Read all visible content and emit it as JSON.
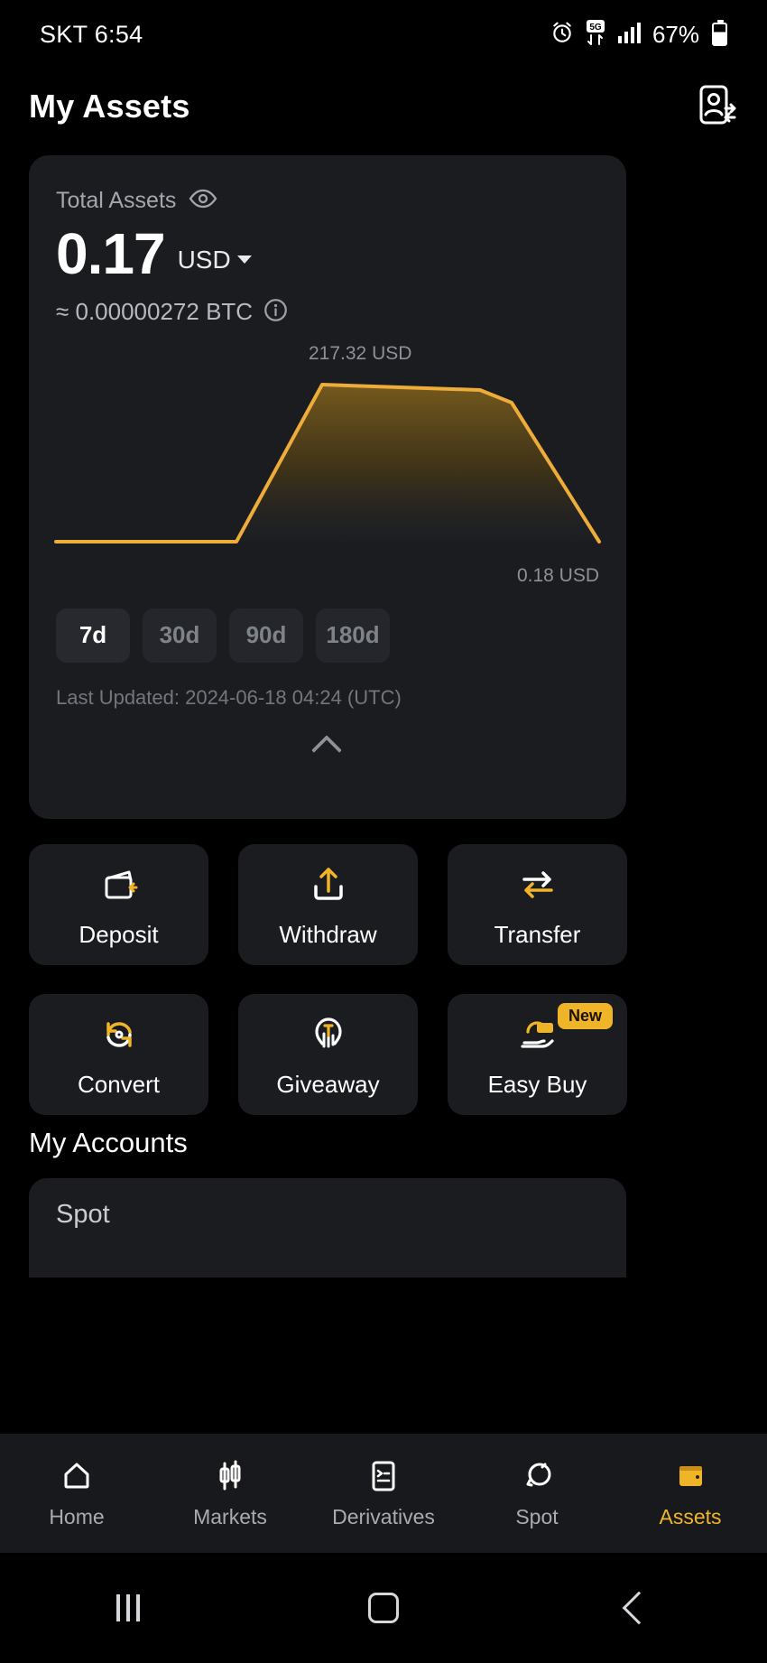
{
  "status_bar": {
    "carrier_time": "SKT 6:54",
    "alarm_icon": "alarm-icon",
    "network_icon": "5g-icon",
    "signal_icon": "signal-bars-icon",
    "battery_percent": "67%",
    "battery_icon": "battery-icon"
  },
  "header": {
    "title": "My Assets",
    "action_icon": "contact-transfer-icon"
  },
  "assets_card": {
    "total_label": "Total Assets",
    "eye_icon": "eye-icon",
    "amount": "0.17",
    "currency": "USD",
    "currency_caret_icon": "chevron-down-icon",
    "btc_equivalent": "≈ 0.00000272 BTC",
    "info_icon": "info-icon",
    "chart_high_label": "217.32 USD",
    "chart_low_label": "0.18 USD",
    "ranges": [
      {
        "label": "7d",
        "active": true
      },
      {
        "label": "30d",
        "active": false
      },
      {
        "label": "90d",
        "active": false
      },
      {
        "label": "180d",
        "active": false
      }
    ],
    "last_updated": "Last Updated: 2024-06-18 04:24 (UTC)",
    "collapse_icon": "chevron-up-icon"
  },
  "chart_data": {
    "type": "area",
    "title": "Total assets over 7 days",
    "xlabel": "",
    "ylabel": "USD",
    "x": [
      0,
      1,
      2,
      3,
      4,
      5,
      6
    ],
    "values": [
      0.18,
      0.18,
      0.18,
      217.32,
      214.0,
      205.0,
      0.18
    ],
    "annotations": [
      "217.32 USD",
      "0.18 USD"
    ],
    "ylim": [
      0,
      217.32
    ],
    "grid": false,
    "legend": "none",
    "line_color": "#eeac3a",
    "fill_color": "#6b521a"
  },
  "actions": [
    {
      "label": "Deposit",
      "icon": "wallet-deposit-icon",
      "badge": null
    },
    {
      "label": "Withdraw",
      "icon": "upload-withdraw-icon",
      "badge": null
    },
    {
      "label": "Transfer",
      "icon": "transfer-arrows-icon",
      "badge": null
    },
    {
      "label": "Convert",
      "icon": "convert-refresh-icon",
      "badge": null
    },
    {
      "label": "Giveaway",
      "icon": "hand-coin-icon",
      "badge": null
    },
    {
      "label": "Easy Buy",
      "icon": "hand-card-icon",
      "badge": "New"
    }
  ],
  "accounts": {
    "section_title": "My Accounts",
    "items": [
      {
        "label": "Spot"
      }
    ]
  },
  "bottom_nav": [
    {
      "label": "Home",
      "icon": "home-icon",
      "active": false
    },
    {
      "label": "Markets",
      "icon": "candlestick-icon",
      "active": false
    },
    {
      "label": "Derivatives",
      "icon": "document-list-icon",
      "active": false
    },
    {
      "label": "Spot",
      "icon": "spot-circles-icon",
      "active": false
    },
    {
      "label": "Assets",
      "icon": "wallet-icon",
      "active": true
    }
  ],
  "system_bar": {
    "recent_icon": "recent-apps-icon",
    "home_icon": "home-square-icon",
    "back_icon": "back-chevron-icon"
  },
  "colors": {
    "accent": "#f0b429",
    "chart_line": "#eeac3a",
    "card_bg": "#1a1c20",
    "page_bg": "#000000"
  }
}
